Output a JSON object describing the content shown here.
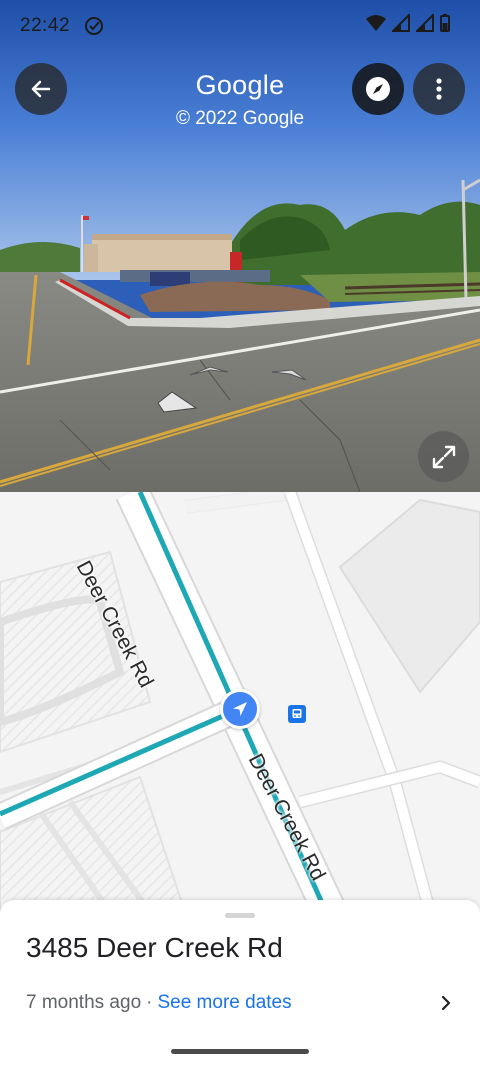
{
  "status_bar": {
    "time": "22:42"
  },
  "streetview": {
    "title": "Google",
    "copyright": "© 2022 Google",
    "icons": [
      "back-arrow-icon",
      "compass-icon",
      "more-vertical-icon",
      "expand-icon"
    ]
  },
  "map": {
    "street_label_1": "Deer Creek Rd",
    "street_label_2": "Deer Creek Rd",
    "colors": {
      "route": "#1ea7b5",
      "location": "#4285f4",
      "bus_stop": "#1a73e8"
    }
  },
  "sheet": {
    "address": "3485 Deer Creek Rd",
    "date_ago": "7 months ago",
    "separator": "·",
    "see_more": "See more dates"
  }
}
